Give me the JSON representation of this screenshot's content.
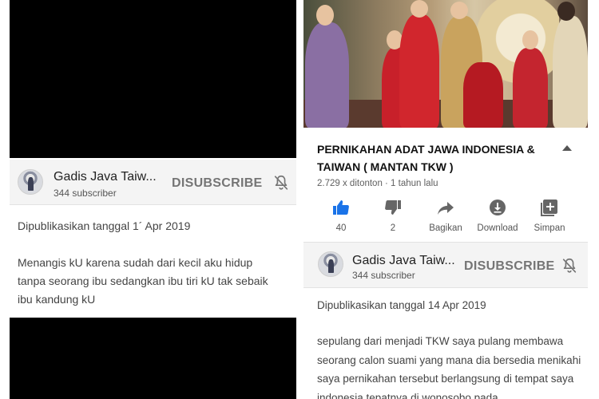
{
  "left": {
    "channel": {
      "name": "Gadis Java Taiw...",
      "subscribers": "344 subscriber",
      "subscribe_label": "DISUBSCRIBE",
      "avatar_icon": "channel-avatar",
      "bell_icon": "bell-off-icon"
    },
    "published": "Dipublikasikan tanggal 1´ Apr 2019",
    "description": "Menangis kU karena sudah dari kecil aku hidup tanpa seorang ibu sedangkan ibu tiri kU tak sebaik ibu kandung kU"
  },
  "right": {
    "video_title": "PERNIKAHAN ADAT JAWA  INDONESIA & TAIWAN ( MANTAN TKW )",
    "meta": "2.729 x ditonton · 1 tahun lalu",
    "actions": [
      {
        "label": "40",
        "icon": "thumb-up-icon"
      },
      {
        "label": "2",
        "icon": "thumb-down-icon"
      },
      {
        "label": "Bagikan",
        "icon": "share-icon"
      },
      {
        "label": "Download",
        "icon": "download-icon"
      },
      {
        "label": "Simpan",
        "icon": "add-to-playlist-icon"
      }
    ],
    "channel": {
      "name": "Gadis Java Taiw...",
      "subscribers": "344 subscriber",
      "subscribe_label": "DISUBSCRIBE",
      "bell_icon": "bell-off-icon"
    },
    "published": "Dipublikasikan tanggal 14 Apr 2019",
    "description": "sepulang dari menjadi TKW saya pulang membawa seorang calon suami yang mana dia bersedia menikahi saya pernikahan tersebut berlangsung di tempat saya indonesia tepatnya di wonosobo pada"
  },
  "colors": {
    "like_blue": "#1a73e8",
    "icon_gray": "#666666",
    "subscribed_gray": "#757575",
    "row_bg": "#f4f4f4"
  }
}
